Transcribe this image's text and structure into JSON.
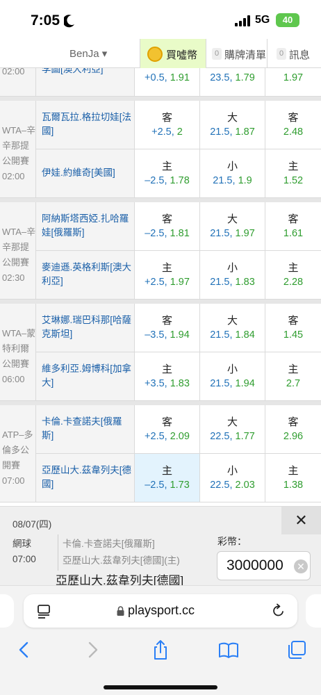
{
  "status_bar": {
    "time": "7:05",
    "network": "5G",
    "battery": "40"
  },
  "nav": {
    "user": "BenJa ▾",
    "buy_label": "買噓幣",
    "tabs": [
      {
        "badge": "0",
        "label": "購牌清單"
      },
      {
        "badge": "0",
        "label": "訊息"
      }
    ]
  },
  "partial_row": {
    "league_time": "02:00",
    "team": "李圖[澳大利亞]",
    "spread": {
      "line": "+0.5",
      "odds": "1.91"
    },
    "total": {
      "line": "23.5",
      "odds": "1.79"
    },
    "ml": {
      "odds": "1.97"
    }
  },
  "matches": [
    {
      "league": [
        "WTA–辛",
        "辛那提",
        "公開賽",
        "02:00"
      ],
      "rows": [
        {
          "team": [
            "瓦爾瓦拉.格拉切娃[法",
            "國]"
          ],
          "spread": {
            "side": "客",
            "line": "+2.5",
            "odds": "2"
          },
          "total": {
            "side": "大",
            "line": "21.5",
            "odds": "1.87"
          },
          "ml": {
            "side": "客",
            "odds": "2.48"
          }
        },
        {
          "team": [
            "伊娃.約維奇[美國]"
          ],
          "spread": {
            "side": "主",
            "line": "–2.5",
            "odds": "1.78"
          },
          "total": {
            "side": "小",
            "line": "21.5",
            "odds": "1.9"
          },
          "ml": {
            "side": "主",
            "odds": "1.52"
          }
        }
      ]
    },
    {
      "league": [
        "WTA–辛",
        "辛那提",
        "公開賽",
        "02:30"
      ],
      "rows": [
        {
          "team": [
            "阿納斯塔西婭.扎哈羅",
            "娃[俄羅斯]"
          ],
          "spread": {
            "side": "客",
            "line": "–2.5",
            "odds": "1.81"
          },
          "total": {
            "side": "大",
            "line": "21.5",
            "odds": "1.97"
          },
          "ml": {
            "side": "客",
            "odds": "1.61"
          }
        },
        {
          "team": [
            "麥迪遜.英格利斯[澳大",
            "利亞]"
          ],
          "spread": {
            "side": "主",
            "line": "+2.5",
            "odds": "1.97"
          },
          "total": {
            "side": "小",
            "line": "21.5",
            "odds": "1.83"
          },
          "ml": {
            "side": "主",
            "odds": "2.28"
          }
        }
      ]
    },
    {
      "league": [
        "WTA–蒙",
        "特利爾",
        "公開賽",
        "06:00"
      ],
      "rows": [
        {
          "team": [
            "艾琳娜.瑞巴科那[哈薩",
            "克斯坦]"
          ],
          "spread": {
            "side": "客",
            "line": "–3.5",
            "odds": "1.94"
          },
          "total": {
            "side": "大",
            "line": "21.5",
            "odds": "1.84"
          },
          "ml": {
            "side": "客",
            "odds": "1.45"
          }
        },
        {
          "team": [
            "維多利亞.姆博科[加拿",
            "大]"
          ],
          "spread": {
            "side": "主",
            "line": "+3.5",
            "odds": "1.83"
          },
          "total": {
            "side": "小",
            "line": "21.5",
            "odds": "1.94"
          },
          "ml": {
            "side": "主",
            "odds": "2.7"
          }
        }
      ]
    },
    {
      "league": [
        "ATP–多",
        "倫多公",
        "開賽",
        "07:00"
      ],
      "rows": [
        {
          "team": [
            "卡倫.卡查諾夫[俄羅",
            "斯]"
          ],
          "spread": {
            "side": "客",
            "line": "+2.5",
            "odds": "2.09"
          },
          "total": {
            "side": "大",
            "line": "22.5",
            "odds": "1.77"
          },
          "ml": {
            "side": "客",
            "odds": "2.96"
          }
        },
        {
          "team": [
            "亞歷山大.茲韋列夫[德",
            "國]"
          ],
          "spread": {
            "side": "主",
            "line": "–2.5",
            "odds": "1.73"
          },
          "total": {
            "side": "小",
            "line": "22.5",
            "odds": "2.03"
          },
          "ml": {
            "side": "主",
            "odds": "1.38"
          }
        }
      ]
    }
  ],
  "bet_slip": {
    "date": "08/07(四)",
    "sport": "網球",
    "time": "07:00",
    "match_line1": "卡倫.卡查諾夫[俄羅斯]",
    "match_line2": "亞歷山大.茲韋列夫[德國](主)",
    "pick": "亞歷山大.茲韋列夫[德國]",
    "stake_label": "彩幣：",
    "stake_value": "3000000",
    "close": "✕"
  },
  "browser": {
    "url": "playsport.cc"
  }
}
